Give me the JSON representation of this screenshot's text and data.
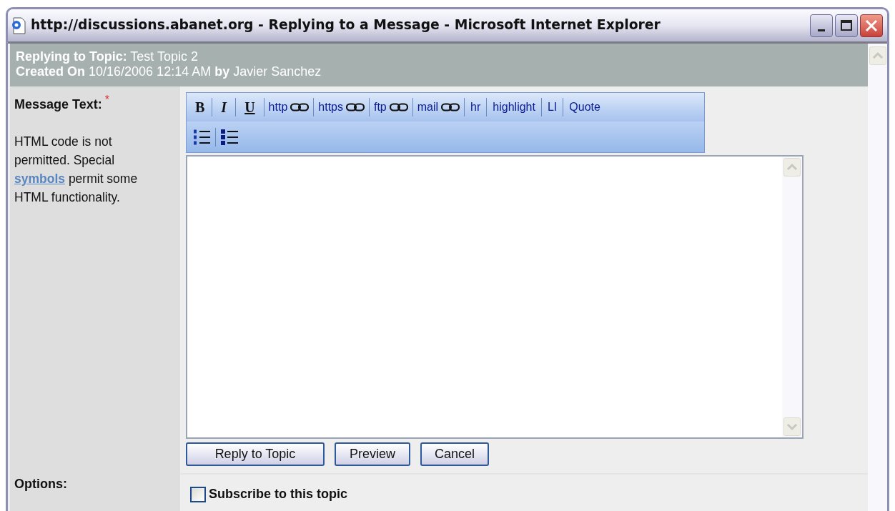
{
  "window": {
    "title": "http://discussions.abanet.org - Replying to a Message - Microsoft Internet Explorer"
  },
  "header": {
    "lines": [
      "**Replying to Topic:** Test Topic 2",
      "**Created On** 10/16/2006 12:14 AM **by** Javier Sanchez"
    ]
  },
  "message": {
    "label": "Message Text:",
    "required_mark": "*",
    "help_before": "HTML code is not permitted. Special",
    "help_link": "symbols",
    "help_after": "permit some HTML functionality."
  },
  "toolbar": {
    "rows": [
      [
        {
          "kind": "bold",
          "label": "B"
        },
        {
          "kind": "italic",
          "label": "I"
        },
        {
          "kind": "underline",
          "label": "U"
        },
        {
          "kind": "link",
          "label": "http"
        },
        {
          "kind": "link",
          "label": "https"
        },
        {
          "kind": "link",
          "label": "ftp"
        },
        {
          "kind": "link",
          "label": "mail"
        },
        {
          "kind": "text",
          "label": "hr"
        },
        {
          "kind": "text",
          "label": "highlight"
        },
        {
          "kind": "text",
          "label": "LI"
        },
        {
          "kind": "text",
          "label": "Quote"
        }
      ],
      [
        {
          "kind": "ordered-list"
        },
        {
          "kind": "bullet-list"
        }
      ]
    ]
  },
  "buttons": [
    "Reply to Topic",
    "Preview",
    "Cancel"
  ],
  "options": {
    "label": "Options:",
    "subscribe": {
      "label": "Subscribe to this topic",
      "checked": false
    }
  }
}
